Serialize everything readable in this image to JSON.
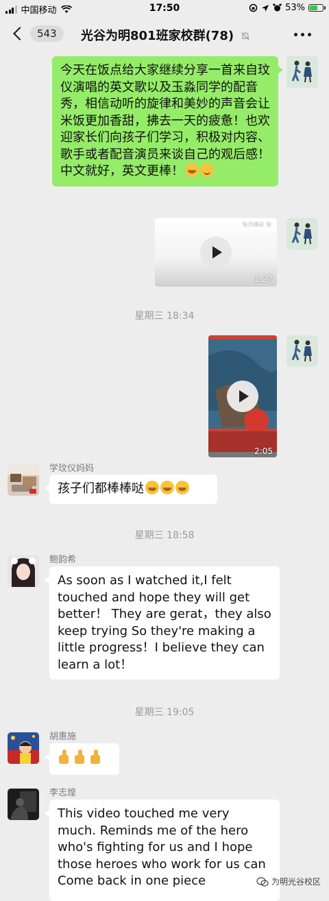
{
  "status_bar": {
    "carrier": "中国移动",
    "time": "17:50",
    "battery": "53%"
  },
  "nav": {
    "back_badge": "543",
    "title": "光谷为明801班家校群(78)"
  },
  "messages": {
    "m1": {
      "text": "今天在饭点给大家继续分享一首来自玟仪演唱的英文歌以及玉淼同学的配音秀，相信动听的旋律和美妙的声音会让米饭更加香甜，拂去一天的疲惫！也欢迎家长们向孩子们学习，积极对内容、歌手或者配音演员来谈自己的观后感！中文就好，英文更棒！"
    },
    "video1": {
      "duration": "1:27",
      "thumb_text": "每日精彩 每"
    },
    "ts1": "星期三 18:34",
    "video2": {
      "duration": "2:05"
    },
    "m2": {
      "sender": "学玟仪妈妈",
      "text": "孩子们都棒棒哒"
    },
    "ts2": "星期三 18:58",
    "m3": {
      "sender": "鲍韵希",
      "text": "As soon as I watched it,I felt touched and hope they will get better！ They are gerat，they also keep trying So they're making  a little progress！I believe they can learn a lot！"
    },
    "ts3": "星期三 19:05",
    "m4": {
      "sender": "胡惠施"
    },
    "m5": {
      "sender": "李志煌",
      "text": "This video touched me very much.  Reminds me of the hero who's fighting for us  and I hope those heroes who work for us can Come  back in one piece"
    }
  },
  "watermark": "为明光谷校区",
  "colors": {
    "bubble_me": "#95ec69",
    "bubble_other": "#ffffff",
    "background": "#ededed"
  }
}
